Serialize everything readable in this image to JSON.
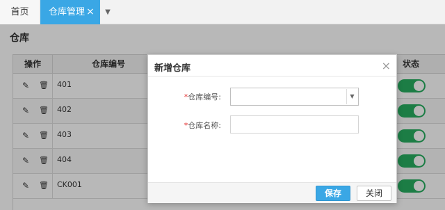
{
  "tabs": {
    "home": "首页",
    "active": "仓库管理",
    "close_glyph": "×",
    "more_glyph": "▼"
  },
  "page": {
    "title": "仓库"
  },
  "grid": {
    "columns": {
      "operation": "操作",
      "code": "仓库编号",
      "status": "状态"
    },
    "rows": [
      {
        "code": "401",
        "status_on": true
      },
      {
        "code": "402",
        "status_on": true
      },
      {
        "code": "403",
        "status_on": true
      },
      {
        "code": "404",
        "status_on": true
      },
      {
        "code": "CK001",
        "status_on": true
      }
    ],
    "icons": {
      "edit": "pencil-icon",
      "delete": "trash-icon"
    }
  },
  "modal": {
    "title": "新增仓库",
    "close_glyph": "×",
    "fields": {
      "code_required": "*",
      "code_label": "仓库编号:",
      "code_value": "",
      "name_required": "*",
      "name_label": "仓库名称:",
      "name_value": "",
      "name_placeholder": ""
    },
    "buttons": {
      "save": "保存",
      "close": "关闭"
    }
  },
  "colors": {
    "accent": "#3aa7e5",
    "toggle_on": "#27ae60"
  }
}
